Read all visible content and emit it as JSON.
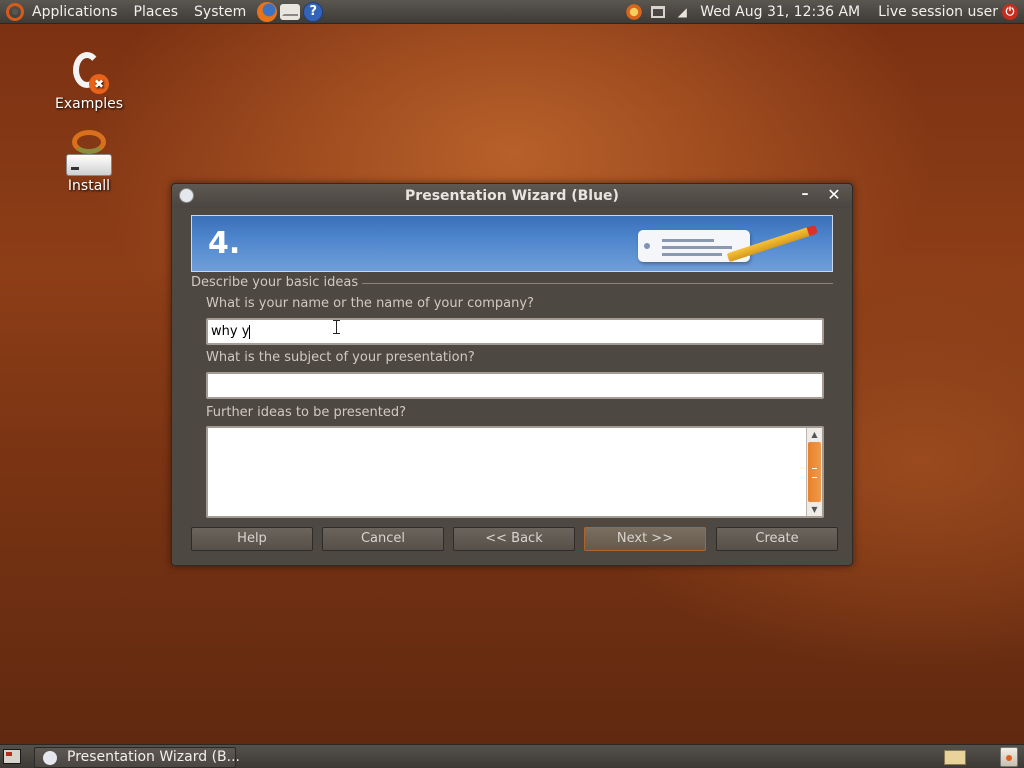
{
  "top_panel": {
    "menus": [
      "Applications",
      "Places",
      "System"
    ],
    "launchers": [
      "firefox-icon",
      "mail-icon",
      "help-icon"
    ],
    "help_glyph": "?",
    "clock": "Wed Aug 31, 12:36 AM",
    "user": "Live session user"
  },
  "desktop": {
    "icons": [
      {
        "label": "Examples",
        "icon": "examples-folder-icon"
      },
      {
        "label": "Install",
        "icon": "install-icon"
      }
    ]
  },
  "dialog": {
    "title": "Presentation Wizard (Blue)",
    "step": "4.",
    "section_label": "Describe your basic ideas",
    "fields": {
      "name_label": "What is your name or the name of your company?",
      "name_value": "why y",
      "subject_label": "What is the subject of your presentation?",
      "subject_value": "",
      "ideas_label": "Further ideas to be presented?",
      "ideas_value": ""
    },
    "buttons": {
      "help": "Help",
      "cancel": "Cancel",
      "back": "<< Back",
      "next": "Next >>",
      "create": "Create"
    }
  },
  "bottom_panel": {
    "task_label": "Presentation Wizard (B..."
  },
  "colors": {
    "accent": "#e8812e",
    "desktop": "#8d3e17",
    "panel": "#3e3b37",
    "banner": "#4d85cc"
  }
}
